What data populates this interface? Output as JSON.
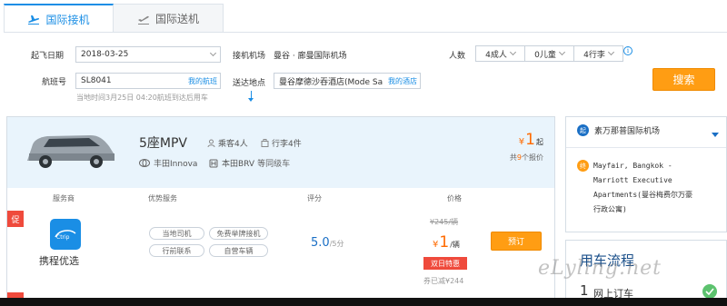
{
  "tabs": [
    {
      "label": "国际接机",
      "active": true,
      "icon": "plane-landing-icon"
    },
    {
      "label": "国际送机",
      "active": false,
      "icon": "plane-takeoff-icon"
    }
  ],
  "form": {
    "date_label": "起飞日期",
    "date_value": "2018-03-25",
    "flight_label": "航班号",
    "flight_value": "SL8041",
    "my_flights": "我的航班",
    "hint": "当地时间3月25日 04:20航班到达后用车",
    "pickup_label": "接机机场",
    "pickup_value": "曼谷 · 廊曼国际机场",
    "dropoff_label": "送达地点",
    "dropoff_value": "曼谷摩德沙吞酒店(Mode Sa",
    "my_hotels": "我的酒店",
    "people_label": "人数",
    "adults": "4成人",
    "children": "0儿童",
    "luggage": "4行李",
    "search_label": "搜索"
  },
  "result": {
    "car_title": "5座MPV",
    "passengers": "乘客4人",
    "luggage": "行李4件",
    "model_1": "丰田Innova",
    "model_2": "本田BRV",
    "model_suffix": "等同级车",
    "from_currency": "¥",
    "from_price": "1",
    "from_suffix": "起",
    "quotes_pre": "共",
    "quotes_count": "9",
    "quotes_post": "个报价",
    "headers": {
      "vendor": "服务商",
      "services": "优势服务",
      "rating": "评分",
      "price": "价格"
    },
    "promo_tag": "促",
    "vendor_name": "携程优选",
    "services": [
      "当地司机",
      "免费举牌接机",
      "行前联系",
      "自营车辆"
    ],
    "score": "5.0",
    "score_out": "/5分",
    "old_price": "¥245/辆",
    "price_currency": "¥",
    "price": "1",
    "price_unit": "/辆",
    "deal_label": "双日特惠",
    "save_text": "券已减¥244",
    "book_label": "预订"
  },
  "side": {
    "airport": "素万那普国际机场",
    "airport_badge": "起",
    "hotel_badge": "终",
    "hotel_lines": [
      "Mayfair, Bangkok -",
      "Marriott Executive",
      "Apartments(曼谷梅费尔万豪",
      "行政公寓)"
    ],
    "flow_title": "用车流程",
    "flow_num": "1",
    "flow_step": "网上订车"
  },
  "watermark": "eLyling.net",
  "colors": {
    "accent": "#1a8ee5",
    "orange": "#ff9d13",
    "price": "#ff6a00",
    "promo": "#ef4a3c"
  }
}
